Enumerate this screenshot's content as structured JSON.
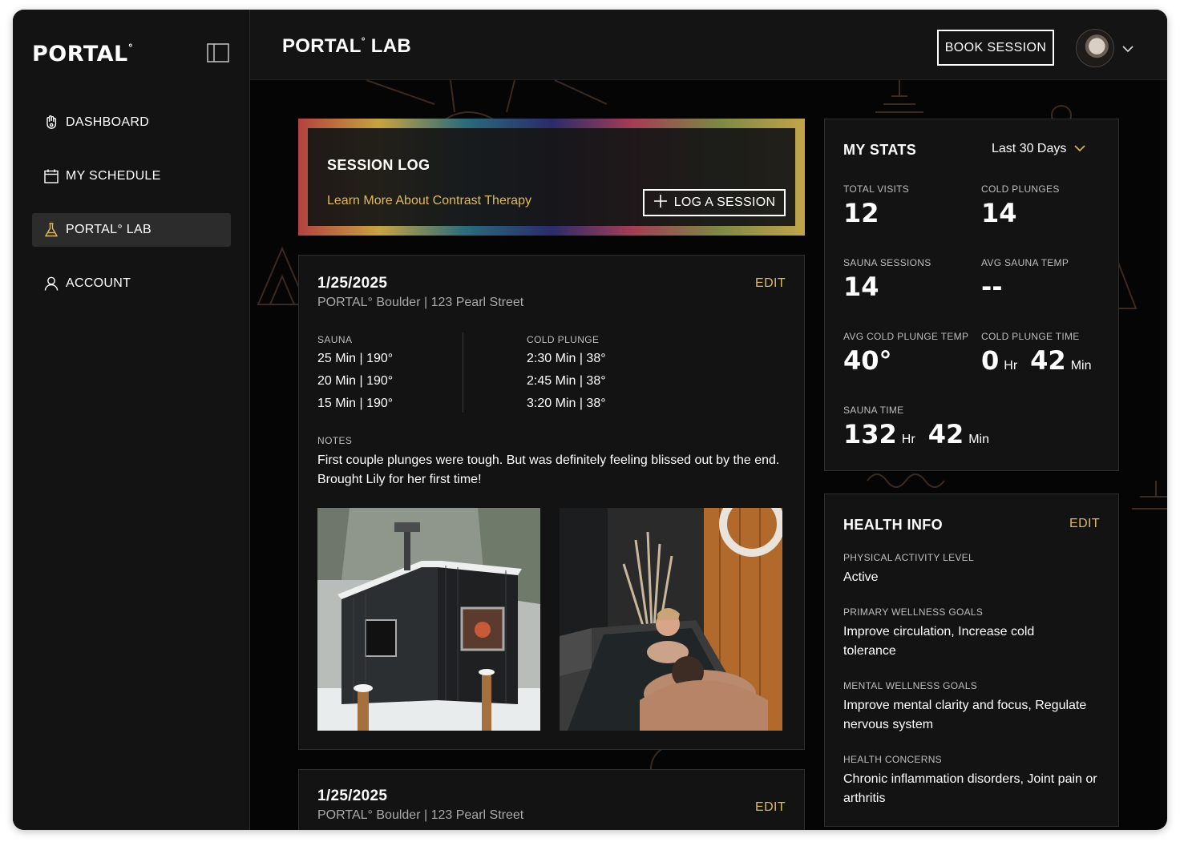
{
  "brand": {
    "logo_text": "PORTAL",
    "logo_degree": "°"
  },
  "sidebar": {
    "items": [
      {
        "label": "DASHBOARD",
        "icon": "hand-icon",
        "active": false
      },
      {
        "label": "MY SCHEDULE",
        "icon": "calendar-icon",
        "active": false
      },
      {
        "label": "PORTAL° LAB",
        "icon": "flask-icon",
        "active": true
      },
      {
        "label": "ACCOUNT",
        "icon": "user-icon",
        "active": false
      }
    ]
  },
  "header": {
    "title": "PORTAL",
    "title_degree": "°",
    "title_suffix": " LAB",
    "book_label": "BOOK SESSION"
  },
  "banner": {
    "title": "SESSION LOG",
    "link": "Learn More About Contrast Therapy",
    "log_button": "LOG A SESSION"
  },
  "sessions": [
    {
      "date": "1/25/2025",
      "location": "PORTAL° Boulder | 123 Pearl Street",
      "edit_label": "EDIT",
      "sauna_label": "SAUNA",
      "sauna": [
        "25 Min | 190°",
        "20 Min | 190°",
        "15 Min | 190°"
      ],
      "cold_label": "COLD PLUNGE",
      "cold": [
        "2:30 Min | 38°",
        "2:45 Min | 38°",
        "3:20 Min | 38°"
      ],
      "notes_label": "NOTES",
      "notes": "First couple plunges were tough. But was definitely feeling blissed out by the end. Brought Lily for her first time!"
    },
    {
      "date": "1/25/2025",
      "location": "PORTAL° Boulder | 123 Pearl Street",
      "edit_label": "EDIT"
    }
  ],
  "stats": {
    "title": "MY STATS",
    "range": "Last 30 Days",
    "total_visits_label": "TOTAL VISITS",
    "total_visits": "12",
    "cold_plunges_label": "COLD PLUNGES",
    "cold_plunges": "14",
    "sauna_sessions_label": "SAUNA SESSIONS",
    "sauna_sessions": "14",
    "avg_sauna_temp_label": "AVG SAUNA TEMP",
    "avg_sauna_temp": "--",
    "avg_cold_temp_label": "AVG COLD PLUNGE TEMP",
    "avg_cold_temp": "40°",
    "cold_time_label": "COLD PLUNGE TIME",
    "cold_time_hr": "0",
    "cold_time_min": "42",
    "sauna_time_label": "SAUNA TIME",
    "sauna_time_hr": "132",
    "sauna_time_min": "42",
    "hr_unit": "Hr",
    "min_unit": "Min"
  },
  "health": {
    "title": "HEALTH INFO",
    "edit_label": "EDIT",
    "activity_label": "PHYSICAL ACTIVITY LEVEL",
    "activity": "Active",
    "primary_label": "PRIMARY WELLNESS GOALS",
    "primary": "Improve circulation, Increase cold tolerance",
    "mental_label": "MENTAL WELLNESS GOALS",
    "mental": "Improve mental clarity and focus, Regulate nervous system",
    "concerns_label": "HEALTH CONCERNS",
    "concerns": "Chronic inflammation disorders, Joint pain or arthritis"
  },
  "colors": {
    "accent": "#e1b95c",
    "background": "#050505",
    "panel": "#131313"
  }
}
